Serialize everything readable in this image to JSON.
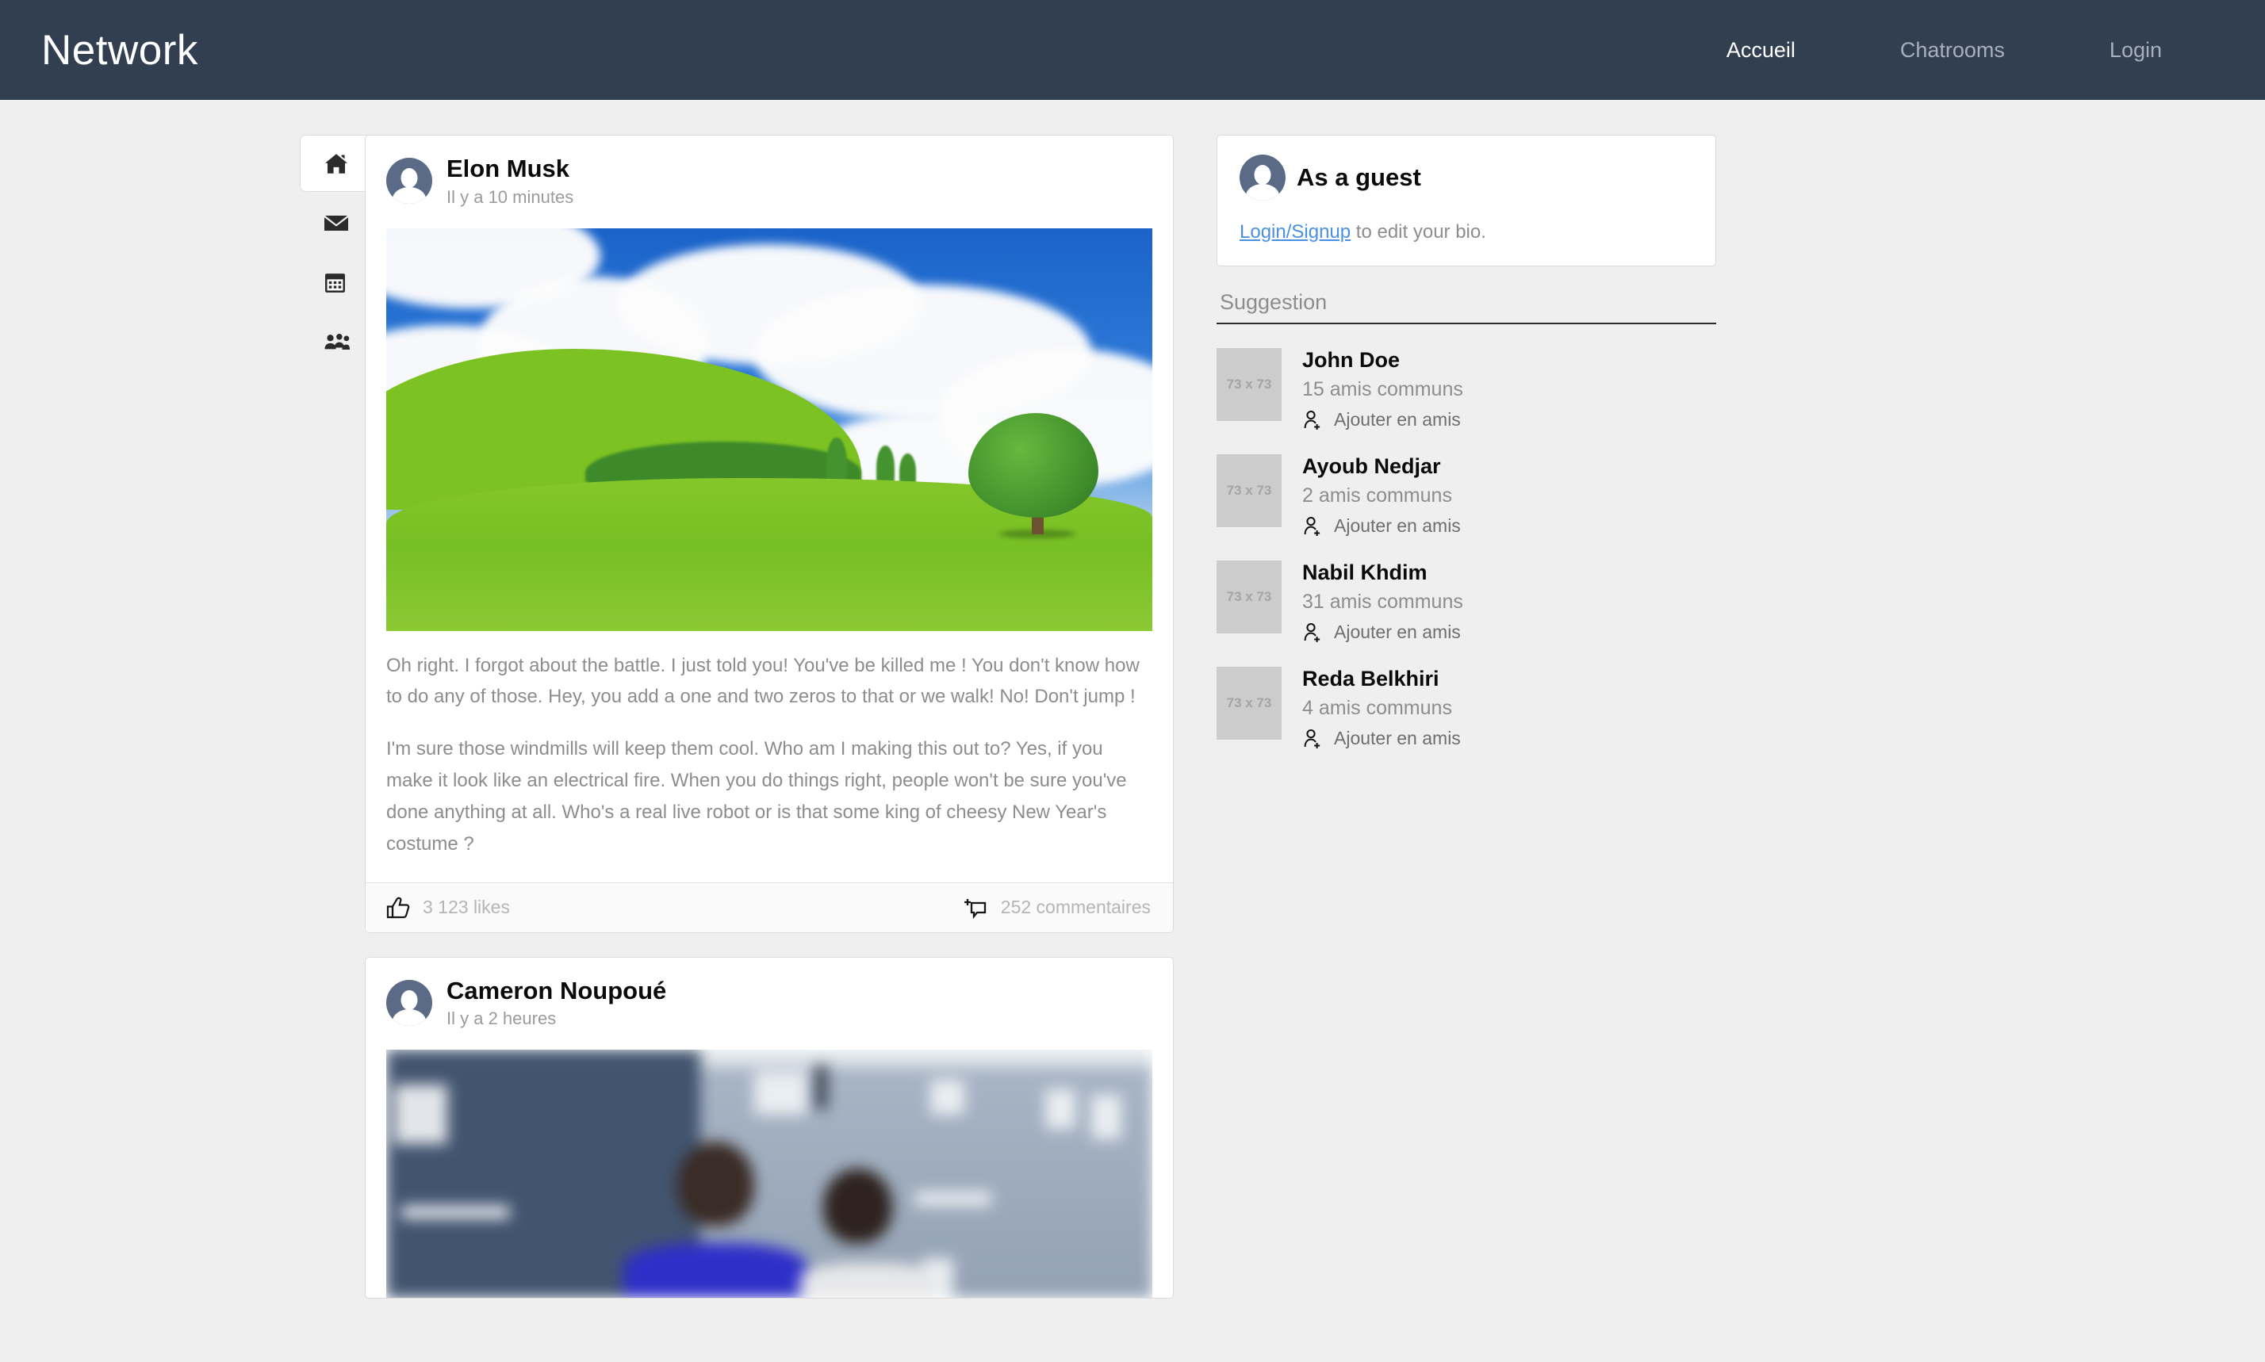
{
  "navbar": {
    "brand": "Network",
    "links": [
      {
        "label": "Accueil",
        "active": true
      },
      {
        "label": "Chatrooms",
        "active": false
      },
      {
        "label": "Login",
        "active": false
      }
    ]
  },
  "sidebar": {
    "items": [
      {
        "label": "News",
        "icon": "home-icon",
        "active": true
      },
      {
        "label": "Messages",
        "icon": "envelope-icon",
        "active": false
      },
      {
        "label": "Events",
        "icon": "calendar-icon",
        "active": false
      },
      {
        "label": "Friends",
        "icon": "users-icon",
        "active": false
      }
    ]
  },
  "feed": {
    "posts": [
      {
        "author": "Elon Musk",
        "time": "Il y a 10 minutes",
        "image": "green-field-landscape",
        "paragraph1": "Oh right. I forgot about the battle. I just told you! You've be killed me ! You don't know how to do any of those. Hey, you add a one and two zeros to that or we walk! No! Don't jump !",
        "paragraph2": "I'm sure those windmills will keep them cool. Who am I making this out to? Yes, if you make it look like an electrical fire. When you do things right, people won't be sure you've done anything at all. Who's a real live robot or is that some king of cheesy New Year's costume ?",
        "likes": "3 123 likes",
        "comments": "252 commentaires"
      },
      {
        "author": "Cameron Noupoué",
        "time": "Il y a 2 heures",
        "image": "blurred-street-photo"
      }
    ]
  },
  "right": {
    "guest": {
      "name": "As a guest",
      "link_label": "Login/Signup",
      "bio_text": " to edit your bio."
    },
    "suggestion_title": "Suggestion",
    "suggestions": [
      {
        "name": "John Doe",
        "mutual": "15 amis communs",
        "thumb": "73 x 73",
        "add_label": "Ajouter en amis"
      },
      {
        "name": "Ayoub Nedjar",
        "mutual": "2 amis communs",
        "thumb": "73 x 73",
        "add_label": "Ajouter en amis"
      },
      {
        "name": "Nabil Khdim",
        "mutual": "31 amis communs",
        "thumb": "73 x 73",
        "add_label": "Ajouter en amis"
      },
      {
        "name": "Reda Belkhiri",
        "mutual": "4 amis communs",
        "thumb": "73 x 73",
        "add_label": "Ajouter en amis"
      }
    ]
  },
  "colors": {
    "navbar_bg": "#323f51",
    "page_bg": "#efefef",
    "card_bg": "#ffffff",
    "link_blue": "#4a90e2",
    "muted_text": "#8d8d8d",
    "avatar_bg": "#5b6a86"
  }
}
